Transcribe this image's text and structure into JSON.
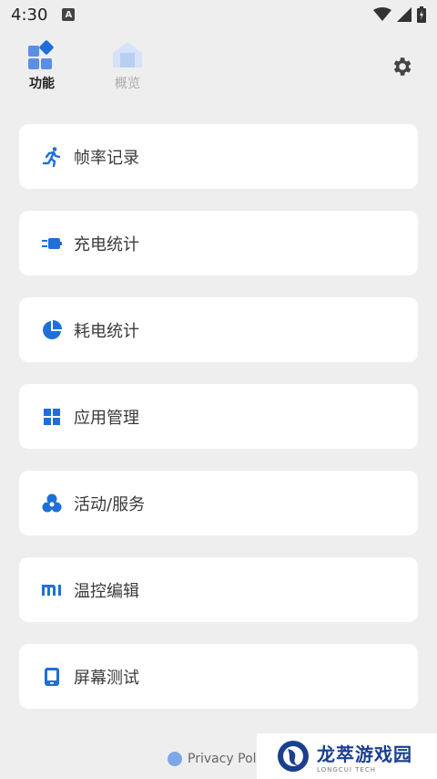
{
  "status": {
    "time": "4:30",
    "a_badge": "A"
  },
  "nav": {
    "tabs": [
      {
        "label": "功能",
        "icon": "widgets-icon"
      },
      {
        "label": "概览",
        "icon": "home-icon"
      }
    ],
    "settings_icon": "gear-icon"
  },
  "menu": {
    "items": [
      {
        "label": "帧率记录",
        "icon": "running-icon"
      },
      {
        "label": "充电统计",
        "icon": "charger-icon"
      },
      {
        "label": "耗电统计",
        "icon": "pie-chart-icon"
      },
      {
        "label": "应用管理",
        "icon": "grid-icon"
      },
      {
        "label": "活动/服务",
        "icon": "circles-icon"
      },
      {
        "label": "温控编辑",
        "icon": "mi-icon"
      },
      {
        "label": "屏幕测试",
        "icon": "tablet-icon"
      }
    ]
  },
  "footer": {
    "privacy": "Privacy Poli"
  },
  "watermark": {
    "cn": "龙萃游戏园",
    "en": "LONGCUI TECH"
  },
  "colors": {
    "accent": "#1e6fd9",
    "background": "#eeeeee",
    "card": "#ffffff"
  }
}
